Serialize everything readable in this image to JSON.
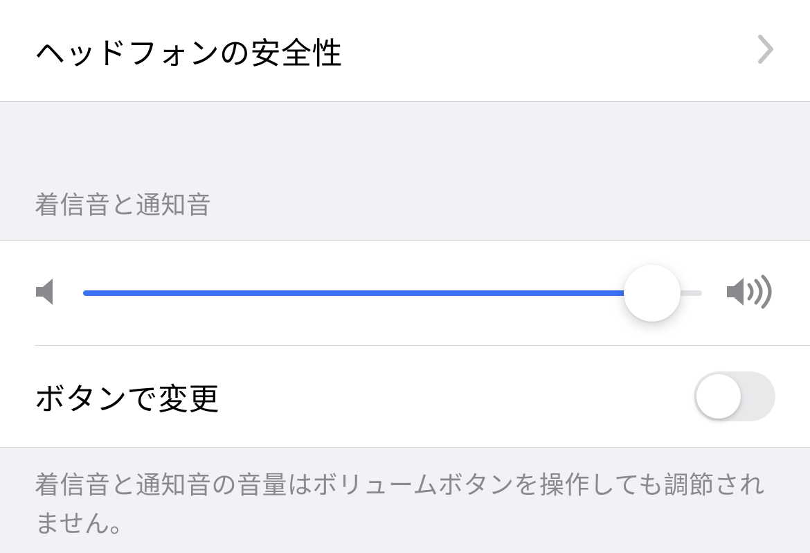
{
  "headphone_safety": {
    "label": "ヘッドフォンの安全性"
  },
  "ringer_section": {
    "header": "着信音と通知音",
    "volume_percent": 92,
    "change_with_buttons": {
      "label": "ボタンで変更",
      "enabled": false
    },
    "footer": "着信音と通知音の音量はボリュームボタンを操作しても調節されません。"
  }
}
